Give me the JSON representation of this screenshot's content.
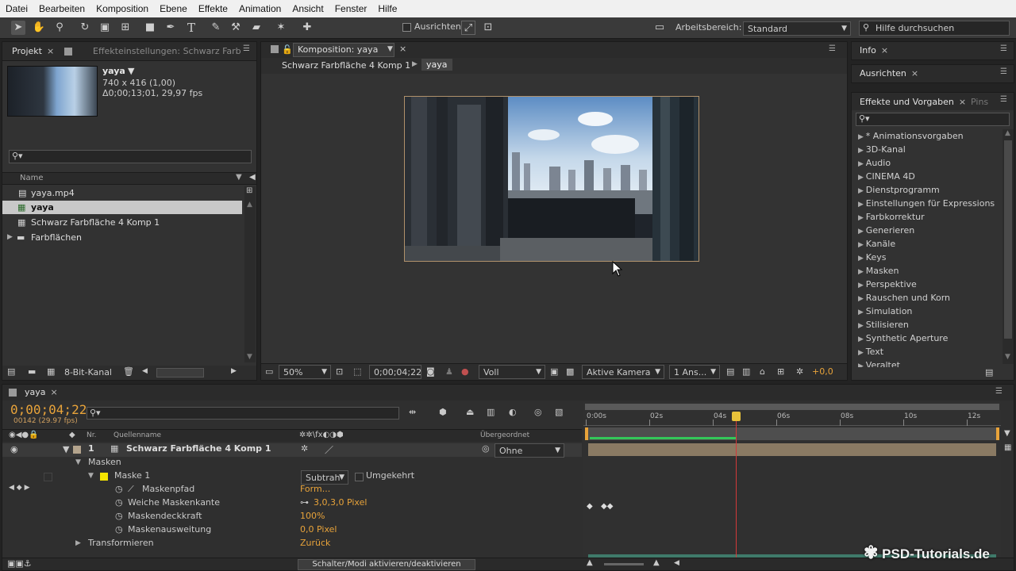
{
  "menu": [
    "Datei",
    "Bearbeiten",
    "Komposition",
    "Ebene",
    "Effekte",
    "Animation",
    "Ansicht",
    "Fenster",
    "Hilfe"
  ],
  "toolbar": {
    "ausrichten_label": "Ausrichten",
    "workspace_label": "Arbeitsbereich:",
    "workspace_value": "Standard",
    "help_placeholder": "Hilfe durchsuchen"
  },
  "project_panel": {
    "tab_label": "Projekt",
    "effects_tab_label": "Effekteinstellungen: Schwarz Farb",
    "preview_name": "yaya",
    "preview_dims": "740 x 416 (1,00)",
    "preview_duration": "Δ0;00;13;01, 29,97 fps",
    "search_placeholder": "",
    "column_name": "Name",
    "items": [
      {
        "label": "yaya.mp4",
        "icon": "video-file-icon"
      },
      {
        "label": "yaya",
        "icon": "composition-icon"
      },
      {
        "label": "Schwarz Farbfläche 4 Komp 1",
        "icon": "composition-icon"
      },
      {
        "label": "Farbflächen",
        "icon": "folder-icon"
      }
    ],
    "bit_depth": "8-Bit-Kanal"
  },
  "comp_panel": {
    "tab_label": "Komposition: yaya",
    "breadcrumb_parent": "Schwarz Farbfläche 4 Komp 1",
    "breadcrumb_current": "yaya",
    "zoom": "50%",
    "timecode": "0;00;04;22",
    "resolution": "Voll",
    "camera": "Aktive Kamera",
    "views": "1 Ans...",
    "exposure": "+0,0"
  },
  "right_panels": {
    "info_label": "Info",
    "align_label": "Ausrichten",
    "effects_label": "Effekte und Vorgaben",
    "pinsel_label": "Pins",
    "effect_categories": [
      "* Animationsvorgaben",
      "3D-Kanal",
      "Audio",
      "CINEMA 4D",
      "Dienstprogramm",
      "Einstellungen für Expressions",
      "Farbkorrektur",
      "Generieren",
      "Kanäle",
      "Keys",
      "Masken",
      "Perspektive",
      "Rauschen und Korn",
      "Simulation",
      "Stilisieren",
      "Synthetic Aperture",
      "Text",
      "Veraltet"
    ]
  },
  "timeline": {
    "tab_label": "yaya",
    "timecode": "0;00;04;22",
    "frame_info": "00142 (29.97 fps)",
    "col_nr": "Nr.",
    "col_source": "Quellenname",
    "col_parent": "Übergeordnet",
    "layer_number": "1",
    "layer_name": "Schwarz Farbfläche 4 Komp 1",
    "layer_parent": "Ohne",
    "masks_label": "Masken",
    "mask1_label": "Maske 1",
    "mask_mode": "Subtrah",
    "inverted_label": "Umgekehrt",
    "props": [
      {
        "name": "Maskenpfad",
        "value": "Form..."
      },
      {
        "name": "Weiche Maskenkante",
        "value": "3,0,3,0 Pixel"
      },
      {
        "name": "Maskendeckkraft",
        "value": "100%"
      },
      {
        "name": "Maskenausweitung",
        "value": "0,0 Pixel"
      }
    ],
    "transform_label": "Transformieren",
    "transform_value": "Zurück",
    "ruler_labels": [
      "0:00s",
      "02s",
      "04s",
      "06s",
      "08s",
      "10s",
      "12s"
    ],
    "playhead_seconds": 4.73,
    "duration_seconds": 13.0,
    "toggle_label": "Schalter/Modi aktivieren/deaktivieren"
  },
  "watermark": "PSD-Tutorials.de",
  "colors": {
    "accent": "#e8a33a",
    "playhead": "#d23a3a",
    "keyframe_bar": "#34c759",
    "layer_bar": "#8a7a63"
  }
}
